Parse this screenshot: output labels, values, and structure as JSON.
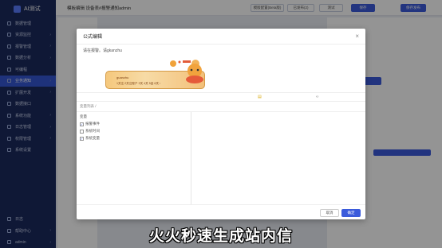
{
  "app": {
    "title": "AI测试"
  },
  "sidebar": {
    "items": [
      {
        "label": "数据管理",
        "chevron": ""
      },
      {
        "label": "资源监控",
        "chevron": "›"
      },
      {
        "label": "报警管理",
        "chevron": "›"
      },
      {
        "label": "数据分析",
        "chevron": "›"
      },
      {
        "label": "可编程",
        "chevron": ""
      },
      {
        "label": "业务通知",
        "chevron": "›"
      },
      {
        "label": "扩展开发",
        "chevron": "›"
      },
      {
        "label": "数据接口",
        "chevron": ""
      },
      {
        "label": "系统功能",
        "chevron": "›"
      },
      {
        "label": "日志管理",
        "chevron": "›"
      },
      {
        "label": "权限管理",
        "chevron": "›"
      },
      {
        "label": "系统设置",
        "chevron": ""
      }
    ],
    "bottom_items": [
      {
        "label": "日志"
      },
      {
        "label": "帮助中心",
        "chevron": "›"
      },
      {
        "label": "admin",
        "chevron": "›"
      }
    ]
  },
  "topbar": {
    "breadcrumb": "模板编辑 设备表#报警通知admin",
    "btn_test": "模版配置(Beta版)",
    "btn_toggle": "已发布(2)",
    "btn_preview": "测试",
    "btn_save": "保存",
    "btn_publish": "保存发布"
  },
  "dialog": {
    "title": "公式编辑",
    "editor_text": "请在报警。请gkanzhu",
    "ime": {
      "composition": "guanzhu",
      "candidates": "1关注 2关注账户 3关 4关 5金 6关 ›"
    },
    "field_list_label": "变量列表 /",
    "tree_root": "变量",
    "tree_items": [
      {
        "label": "报警事件",
        "checked": "✓"
      },
      {
        "label": "系统时间",
        "checked": ""
      },
      {
        "label": "系统变量",
        "checked": "✓"
      }
    ],
    "cancel_label": "取消",
    "ok_label": "确定"
  },
  "subtitle": "火火秒速生成站内信"
}
